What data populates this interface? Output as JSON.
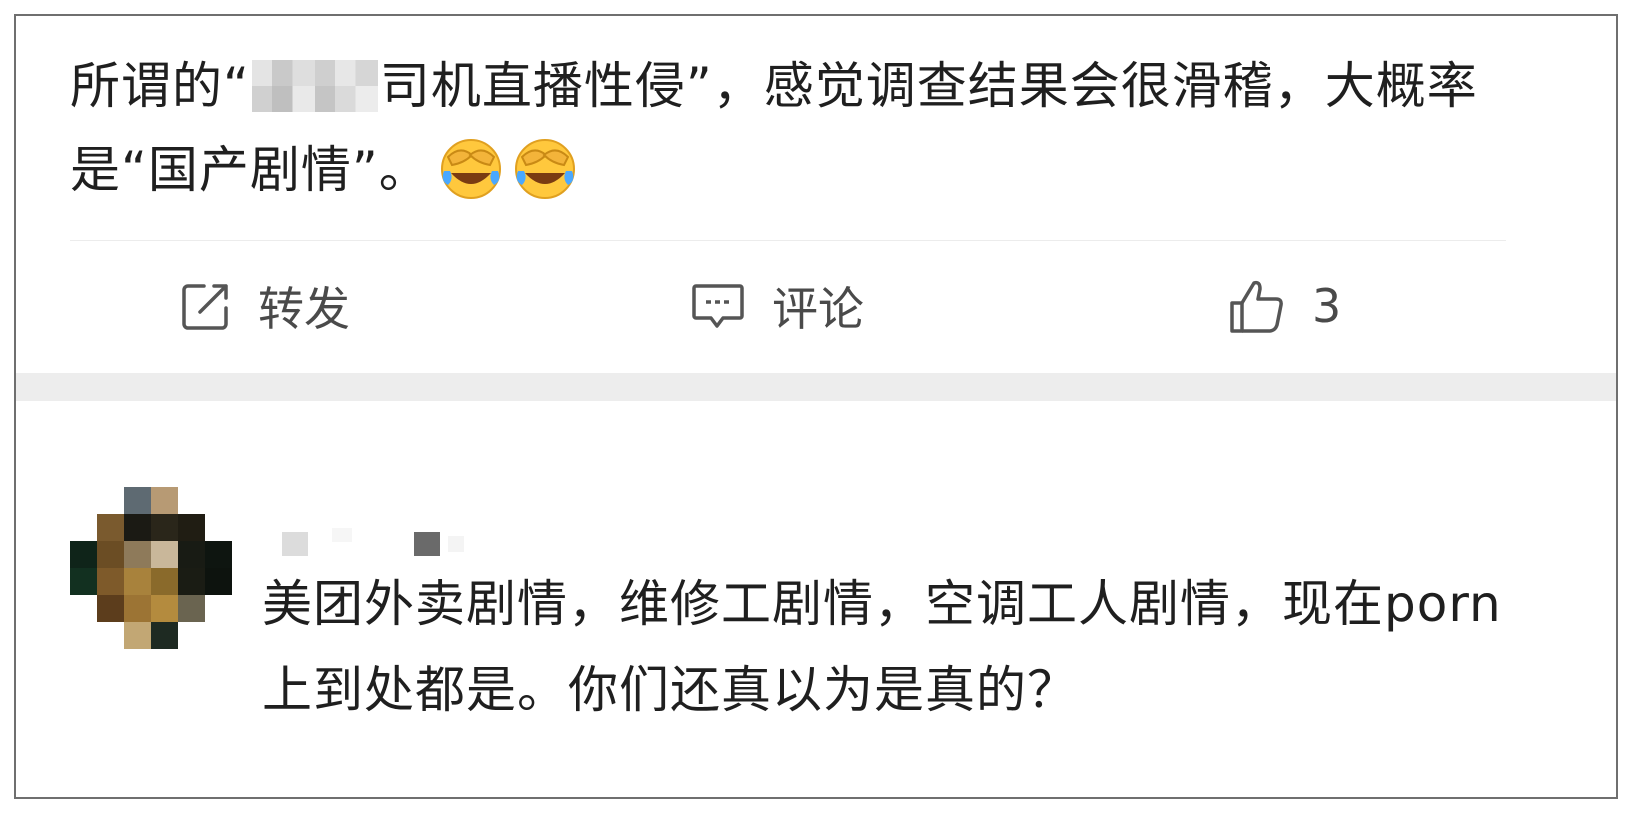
{
  "post": {
    "text_before_redaction": "所谓的“",
    "text_after_redaction": "司机直播性侵”，感觉调查结果会很滑稽，大概率是“国产剧情”。",
    "emojis": [
      "laugh-crying-face-icon",
      "laugh-crying-face-icon"
    ]
  },
  "actions": {
    "repost_label": "转发",
    "comment_label": "评论",
    "like_count": "3"
  },
  "comment": {
    "text": "美团外卖剧情，维修工剧情，空调工人剧情，现在porn上到处都是。你们还真以为是真的？"
  },
  "colors": {
    "text": "#1f1f1f",
    "action_text": "#4a4a4a",
    "section_gap": "#ededed",
    "border": "#6f6f6f"
  }
}
